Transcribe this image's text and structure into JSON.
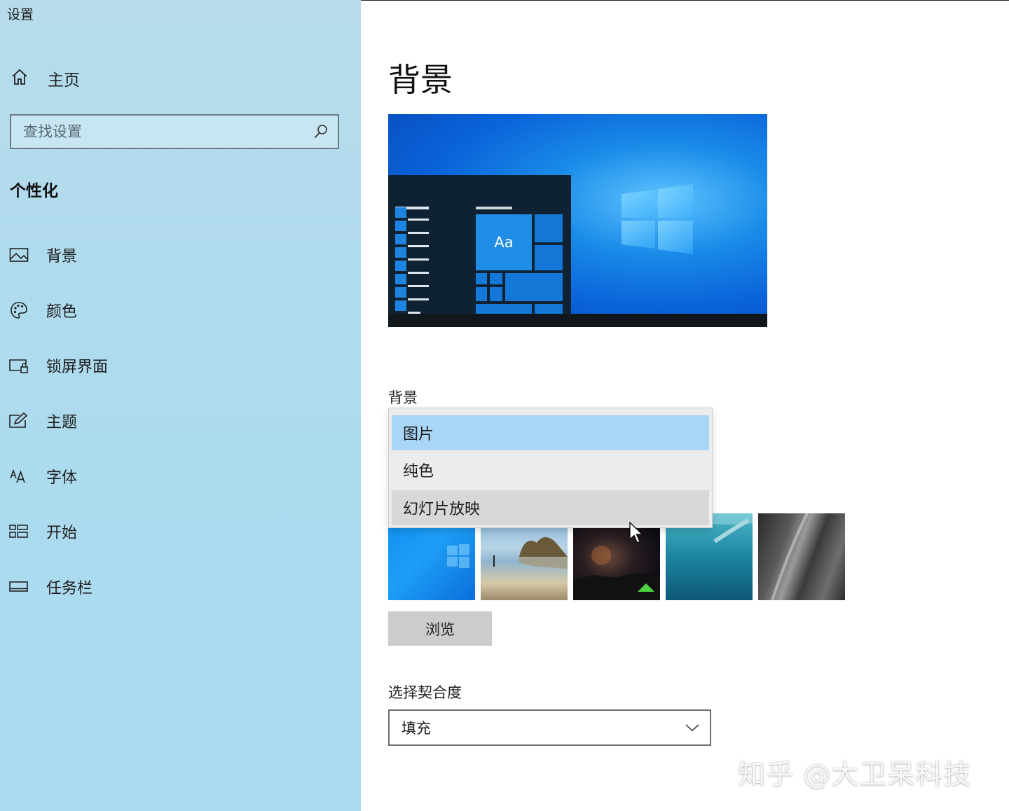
{
  "window": {
    "title": "设置"
  },
  "sidebar": {
    "home_label": "主页",
    "search_placeholder": "查找设置",
    "section_title": "个性化",
    "items": [
      {
        "label": "背景",
        "icon": "picture-icon"
      },
      {
        "label": "颜色",
        "icon": "palette-icon"
      },
      {
        "label": "锁屏界面",
        "icon": "lock-screen-icon"
      },
      {
        "label": "主题",
        "icon": "theme-icon"
      },
      {
        "label": "字体",
        "icon": "font-icon"
      },
      {
        "label": "开始",
        "icon": "start-icon"
      },
      {
        "label": "任务栏",
        "icon": "taskbar-icon"
      }
    ]
  },
  "main": {
    "title": "背景",
    "preview": {
      "tile_text": "Aa"
    },
    "background_label": "背景",
    "background_options": [
      "图片",
      "纯色",
      "幻灯片放映"
    ],
    "background_selected": "图片",
    "background_hovered": "幻灯片放映",
    "browse_label": "浏览",
    "fit_label": "选择契合度",
    "fit_value": "填充"
  },
  "watermark": "知乎 @大卫呆科技",
  "colors": {
    "sidebar_bg": "#aedbee",
    "selected_option": "#a9d5f6",
    "hover_option": "#d8d8d8",
    "accent": "#0a63d9",
    "button_bg": "#cccccc"
  }
}
